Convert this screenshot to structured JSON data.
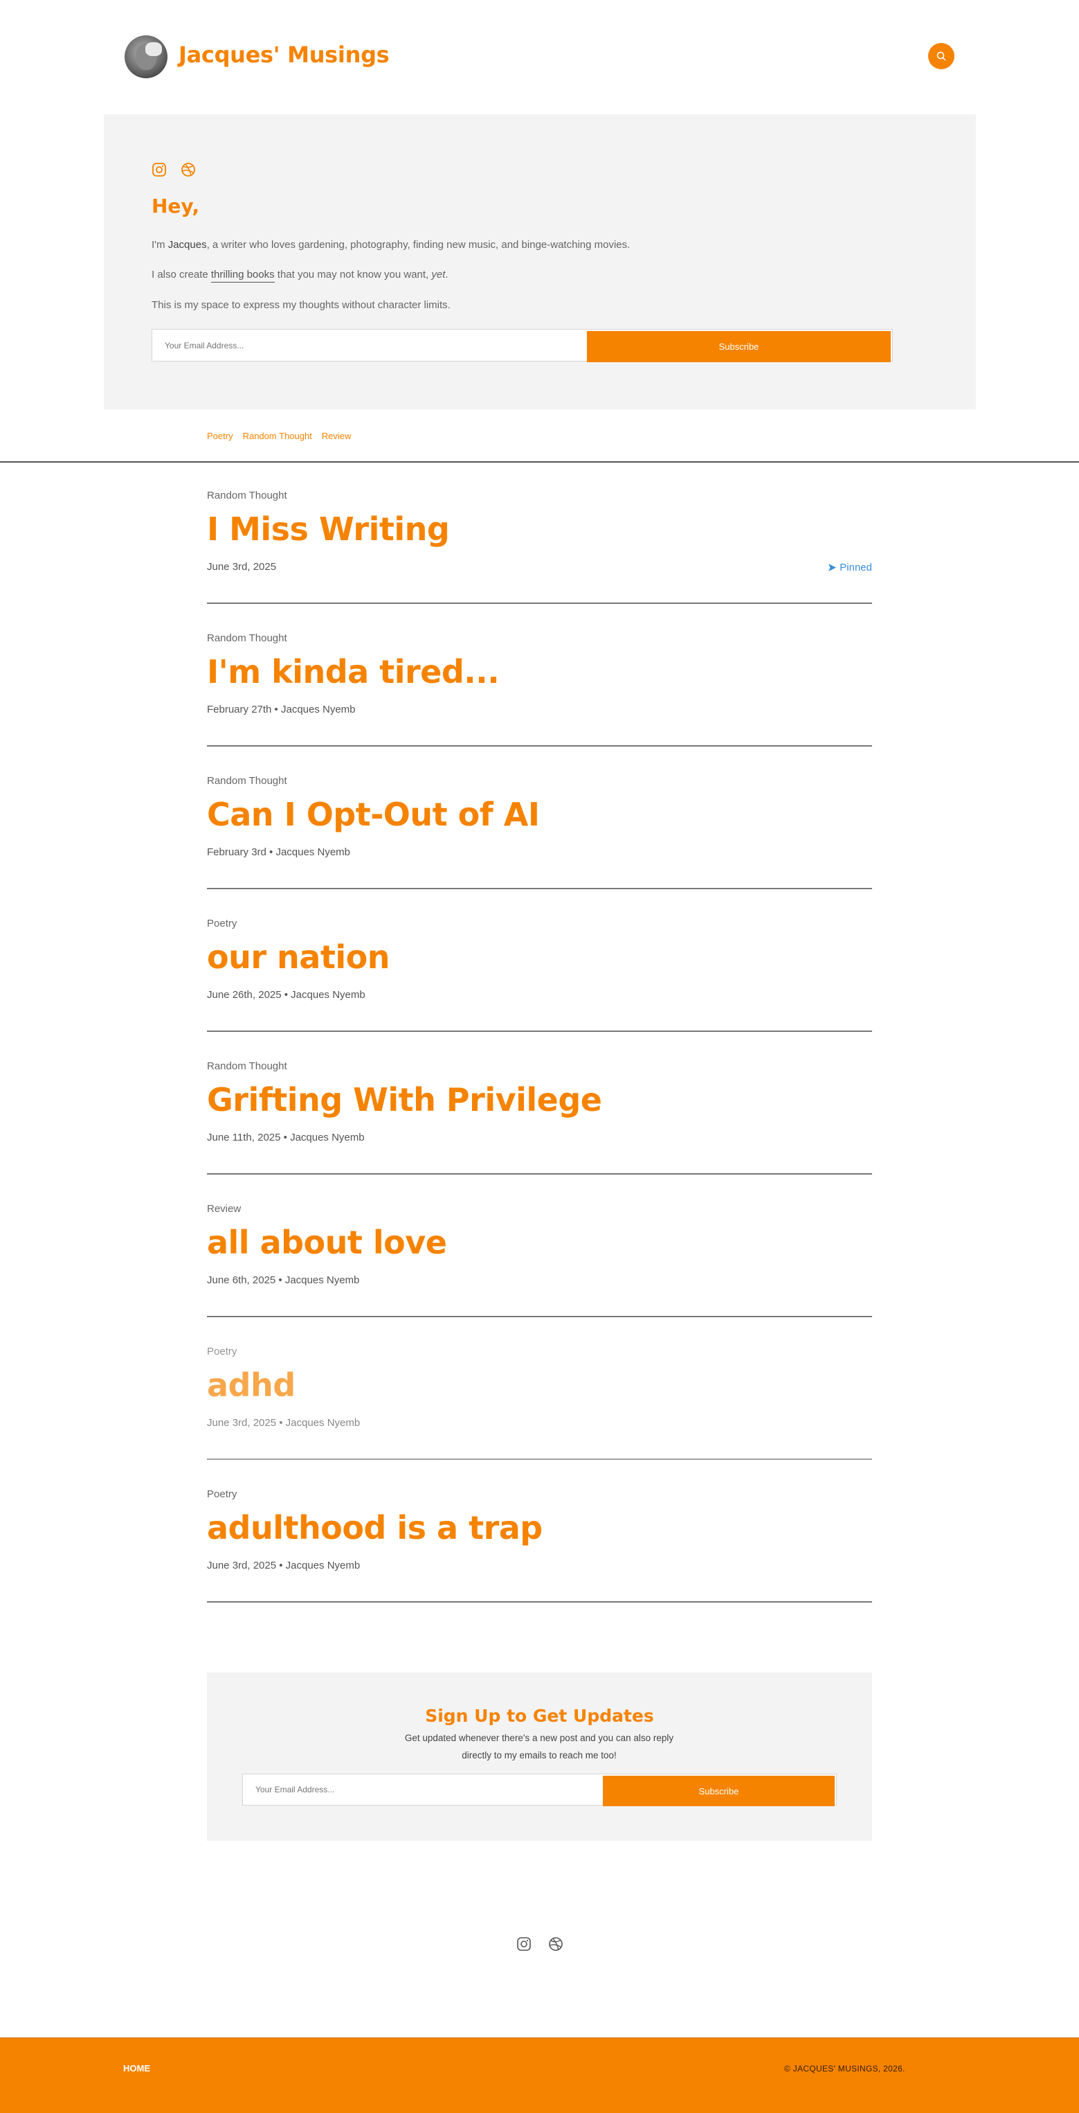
{
  "header": {
    "site_title": "Jacques' Musings"
  },
  "hero": {
    "greeting": "Hey,",
    "intro_prefix": "I'm ",
    "intro_name": "Jacques",
    "intro_rest": ", a writer who loves gardening, photography, finding new music, and binge-watching movies.",
    "books_prefix": "I also create ",
    "books_link": "thrilling books",
    "books_middle": " that you may not know you want, ",
    "books_yet": "yet",
    "books_end": ".",
    "space_line": "This is my space to express my thoughts without character limits.",
    "email_placeholder": "Your Email Address...",
    "subscribe_label": "Subscribe"
  },
  "tags": [
    "Poetry",
    "Random Thought",
    "Review"
  ],
  "pinned_label": "Pinned",
  "posts": [
    {
      "category": "Random Thought",
      "title": "I Miss Writing",
      "meta": "June 3rd, 2025"
    },
    {
      "category": "Random Thought",
      "title": "I'm kinda tired...",
      "meta": "February 27th • Jacques Nyemb"
    },
    {
      "category": "Random Thought",
      "title": "Can I Opt-Out of AI",
      "meta": "February 3rd • Jacques Nyemb"
    },
    {
      "category": "Poetry",
      "title": "our nation",
      "meta": "June 26th, 2025 • Jacques Nyemb"
    },
    {
      "category": "Random Thought",
      "title": "Grifting With Privilege",
      "meta": "June 11th, 2025 • Jacques Nyemb"
    },
    {
      "category": "Review",
      "title": "all about love",
      "meta": "June 6th, 2025 • Jacques Nyemb"
    },
    {
      "category": "Poetry",
      "title": "adhd",
      "meta": "June 3rd, 2025 • Jacques Nyemb"
    },
    {
      "category": "Poetry",
      "title": "adulthood is a trap",
      "meta": "June 3rd, 2025 • Jacques Nyemb"
    }
  ],
  "signup": {
    "title": "Sign Up to Get Updates",
    "description": "Get updated whenever there's a new post and you can also reply directly to my emails to reach me too!",
    "email_placeholder": "Your Email Address...",
    "subscribe_label": "Subscribe"
  },
  "footer": {
    "home_label": "HOME",
    "copyright": "© JACQUES' MUSINGS, 2026."
  },
  "colors": {
    "accent": "#f58300",
    "panel": "#f3f3f3",
    "pinned": "#3a8fd9"
  },
  "icons": {
    "social": [
      "instagram-icon",
      "dribbble-icon"
    ],
    "search": "search-icon"
  }
}
